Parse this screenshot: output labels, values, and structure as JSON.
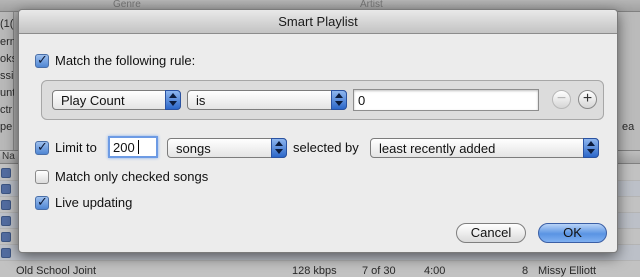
{
  "background": {
    "header_columns": [
      "Genre",
      "Artist"
    ],
    "left_fragments": [
      "(1(",
      "ern",
      "oks",
      "ssi",
      "unt",
      "ctr",
      "pe"
    ],
    "right_fragment": "ea",
    "list_column_header": "Na",
    "last_row": {
      "name": "Old School Joint",
      "bitrate": "128 kbps",
      "track": "7 of 30",
      "time": "4:00",
      "count": "8",
      "artist": "Missy Elliott"
    }
  },
  "dialog": {
    "title": "Smart Playlist",
    "match_rule": {
      "label": "Match the following rule:",
      "checked": true
    },
    "rule": {
      "field": "Play Count",
      "operator": "is",
      "value": "0",
      "remove_symbol": "−",
      "add_symbol": "+"
    },
    "limit": {
      "label": "Limit to",
      "checked": true,
      "value": "200",
      "unit": "songs",
      "selected_by_label": "selected by",
      "selected_by": "least recently added"
    },
    "match_checked": {
      "label": "Match only checked songs",
      "checked": false
    },
    "live_updating": {
      "label": "Live updating",
      "checked": true
    },
    "cancel_label": "Cancel",
    "ok_label": "OK"
  },
  "colors": {
    "accent": "#4f86d3",
    "sheet_background": "#ececec"
  }
}
